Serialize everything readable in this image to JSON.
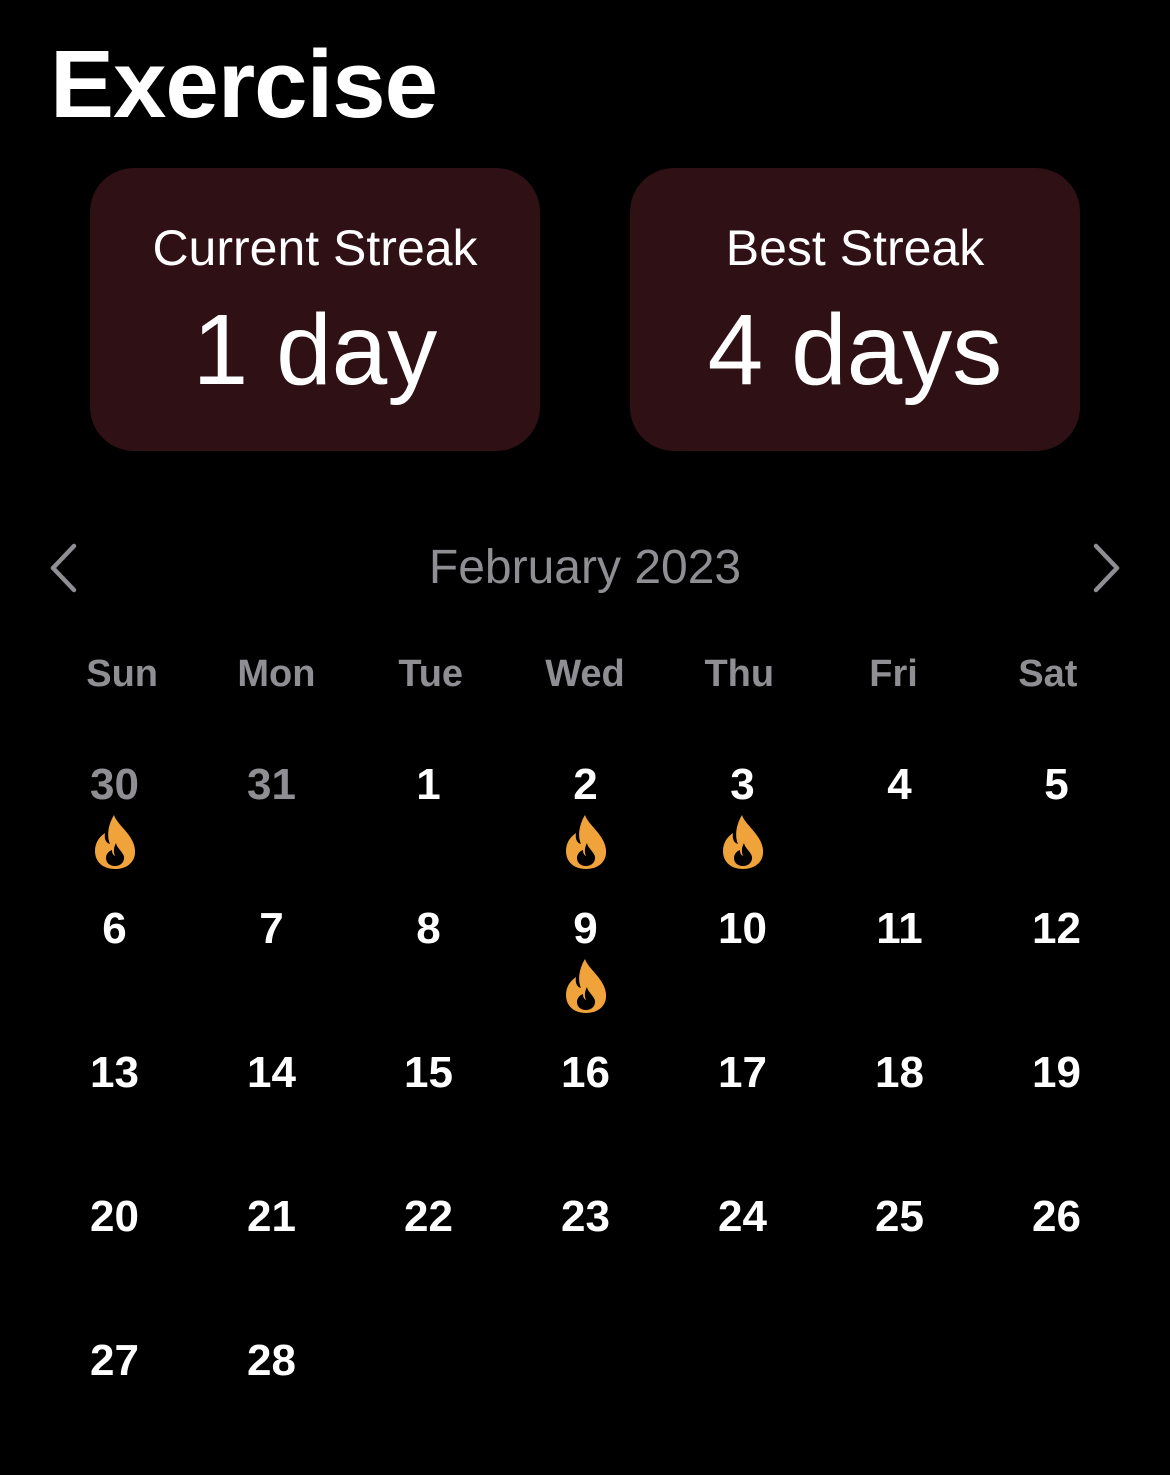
{
  "page": {
    "title": "Exercise"
  },
  "streaks": {
    "current": {
      "label": "Current Streak",
      "value": "1 day"
    },
    "best": {
      "label": "Best Streak",
      "value": "4 days"
    }
  },
  "calendar": {
    "month_label": "February 2023",
    "prev_icon": "chevron-left-icon",
    "next_icon": "chevron-right-icon",
    "weekdays": [
      "Sun",
      "Mon",
      "Tue",
      "Wed",
      "Thu",
      "Fri",
      "Sat"
    ],
    "days": [
      {
        "label": "30",
        "muted": true,
        "streak": true
      },
      {
        "label": "31",
        "muted": true,
        "streak": false
      },
      {
        "label": "1",
        "muted": false,
        "streak": false
      },
      {
        "label": "2",
        "muted": false,
        "streak": true
      },
      {
        "label": "3",
        "muted": false,
        "streak": true
      },
      {
        "label": "4",
        "muted": false,
        "streak": false
      },
      {
        "label": "5",
        "muted": false,
        "streak": false
      },
      {
        "label": "6",
        "muted": false,
        "streak": false
      },
      {
        "label": "7",
        "muted": false,
        "streak": false
      },
      {
        "label": "8",
        "muted": false,
        "streak": false
      },
      {
        "label": "9",
        "muted": false,
        "streak": true
      },
      {
        "label": "10",
        "muted": false,
        "streak": false
      },
      {
        "label": "11",
        "muted": false,
        "streak": false
      },
      {
        "label": "12",
        "muted": false,
        "streak": false
      },
      {
        "label": "13",
        "muted": false,
        "streak": false
      },
      {
        "label": "14",
        "muted": false,
        "streak": false
      },
      {
        "label": "15",
        "muted": false,
        "streak": false
      },
      {
        "label": "16",
        "muted": false,
        "streak": false
      },
      {
        "label": "17",
        "muted": false,
        "streak": false
      },
      {
        "label": "18",
        "muted": false,
        "streak": false
      },
      {
        "label": "19",
        "muted": false,
        "streak": false
      },
      {
        "label": "20",
        "muted": false,
        "streak": false
      },
      {
        "label": "21",
        "muted": false,
        "streak": false
      },
      {
        "label": "22",
        "muted": false,
        "streak": false
      },
      {
        "label": "23",
        "muted": false,
        "streak": false
      },
      {
        "label": "24",
        "muted": false,
        "streak": false
      },
      {
        "label": "25",
        "muted": false,
        "streak": false
      },
      {
        "label": "26",
        "muted": false,
        "streak": false
      },
      {
        "label": "27",
        "muted": false,
        "streak": false
      },
      {
        "label": "28",
        "muted": false,
        "streak": false
      }
    ],
    "streak_icon": "flame-icon"
  },
  "colors": {
    "background": "#000000",
    "card": "#2e1015",
    "muted_text": "#8e8e93",
    "flame": "#f0a23b"
  }
}
